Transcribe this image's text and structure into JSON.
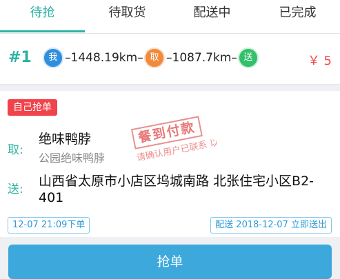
{
  "tabs": [
    {
      "label": "待抢"
    },
    {
      "label": "待取货"
    },
    {
      "label": "配送中"
    },
    {
      "label": "已完成"
    }
  ],
  "order": {
    "number": "#1",
    "route": {
      "me_label": "我",
      "distance_to_pickup": "–1448.19km–",
      "pickup_label": "取",
      "distance_to_delivery": "–1087.7km–",
      "delivery_label": "送"
    },
    "price": "￥ 5"
  },
  "card": {
    "badge": "自己抢单",
    "take_label": "取:",
    "shop_name": "绝味鸭脖",
    "shop_subtitle": "公园绝味鸭脖",
    "send_label": "送:",
    "address": "山西省太原市小店区坞城南路 北张住宅小区B2-401",
    "order_time": "12-07 21:09下单",
    "delivery_time": "配送 2018-12-07 立即送出",
    "stamp_title": "餐到付款",
    "stamp_note": "请确认用户已联系 以免造成损失"
  },
  "action": {
    "label": "抢单"
  },
  "colors": {
    "accent": "#2bb3a3",
    "price": "#f24b4b",
    "button": "#3da8dc",
    "badge": "#f0434b"
  }
}
